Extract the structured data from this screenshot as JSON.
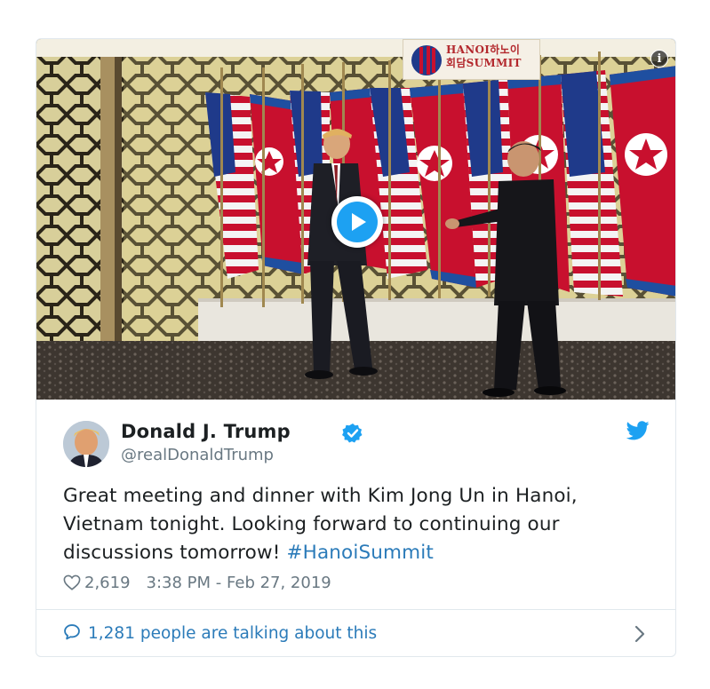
{
  "media": {
    "banner_line1": "HANOI하노이",
    "banner_line2": "회담SUMMIT",
    "info_icon": "info-icon",
    "play_icon": "play-icon"
  },
  "author": {
    "name": "Donald J. Trump",
    "handle": "@realDonaldTrump",
    "verified_icon": "verified-badge-icon",
    "avatar": "avatar"
  },
  "tweet": {
    "text": "Great meeting and dinner with Kim Jong Un in Hanoi, Vietnam tonight. Looking forward to continuing our discussions tomorrow! ",
    "hashtag": "#HanoiSummit"
  },
  "meta": {
    "likes": "2,619",
    "timestamp": "3:38 PM - Feb 27, 2019"
  },
  "footer": {
    "talking": "1,281 people are talking about this"
  },
  "colors": {
    "accent": "#1da1f2",
    "link": "#2b7bb9",
    "text": "#1c2022",
    "muted": "#697882",
    "border": "#e1e8ed"
  }
}
